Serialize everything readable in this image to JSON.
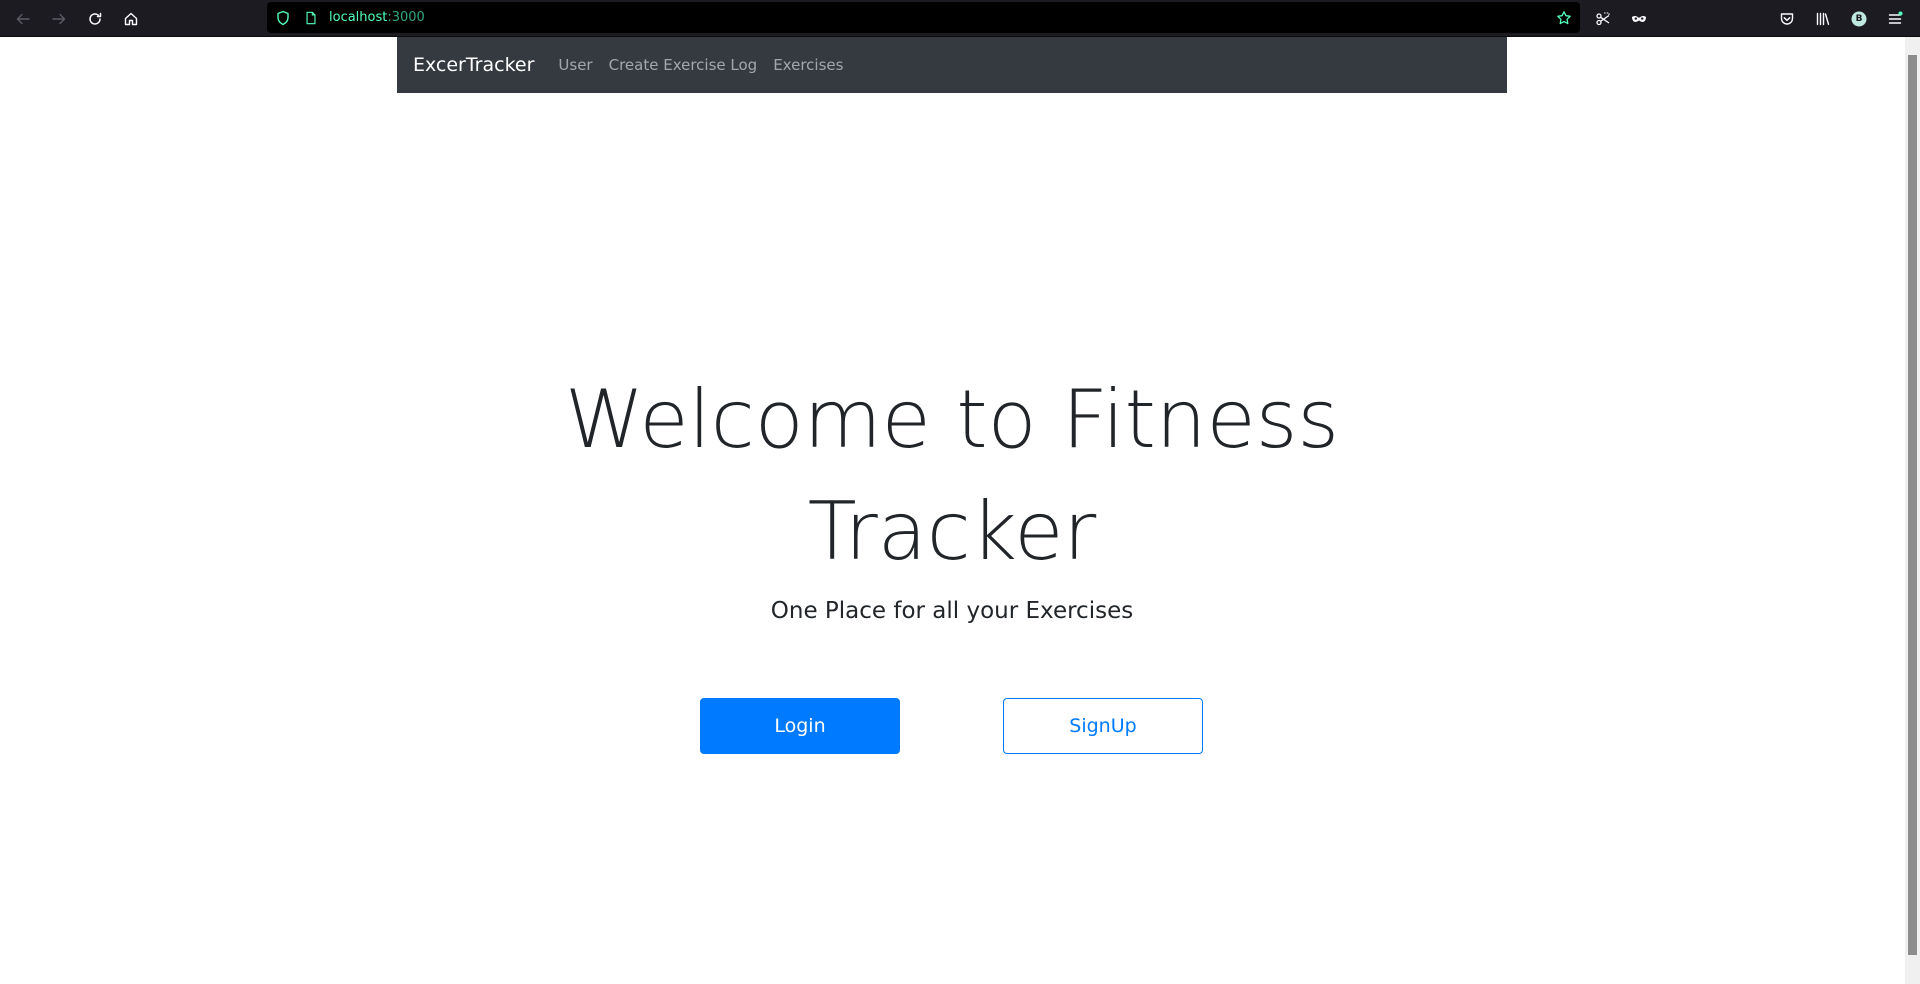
{
  "browser": {
    "url_host": "localhost",
    "url_port": ":3000",
    "toolbar_icons": [
      "back-icon",
      "forward-icon",
      "reload-icon",
      "home-icon",
      "tracking-shield-icon",
      "page-icon",
      "bookmark-star-icon",
      "screenshot-icon",
      "mask-icon",
      "pocket-icon",
      "library-icon",
      "account-icon",
      "menu-icon"
    ],
    "account_initial": "B",
    "accent_color": "#54ffbd"
  },
  "navbar": {
    "brand": "ExcerTracker",
    "links": [
      "User",
      "Create Exercise Log",
      "Exercises"
    ],
    "background_color": "#343a40"
  },
  "hero": {
    "title": "Welcome to Fitness Tracker",
    "subtitle": "One Place for all your Exercises"
  },
  "actions": {
    "login_label": "Login",
    "signup_label": "SignUp",
    "primary_color": "#007bff"
  }
}
